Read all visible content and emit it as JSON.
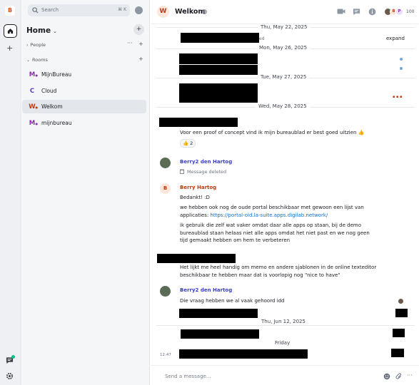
{
  "rail": {
    "logo_letter": "B",
    "accent": "#e0500f"
  },
  "sidebar": {
    "search": {
      "placeholder": "Search",
      "shortcut": "⌘ K"
    },
    "title": "Home",
    "sections": [
      {
        "label": "People"
      },
      {
        "label": "Rooms"
      }
    ],
    "rooms": [
      {
        "letter": "M",
        "name": "MijnBureau",
        "color": "#8a2ab0",
        "active": false
      },
      {
        "letter": "C",
        "name": "Cloud",
        "color": "#5b3cc4",
        "active": false
      },
      {
        "letter": "W",
        "name": "Welkom",
        "color": "#c0390c",
        "active": true
      },
      {
        "letter": "M",
        "name": "mijnbureau",
        "color": "#8a2ab0",
        "active": false
      }
    ]
  },
  "header": {
    "room_letter": "W",
    "room_name": "Welkom",
    "member_count": "100",
    "icons": [
      "video-icon",
      "threads-icon",
      "info-icon"
    ]
  },
  "timeline": {
    "dates": [
      "Thu, May 22, 2025",
      "Mon, May 26, 2025",
      "Tue, May 27, 2025",
      "Wed, May 28, 2025",
      "Thu, Jun 12, 2025",
      "Friday"
    ],
    "expand_label": "expand",
    "messages": {
      "proof": "Voor een proof of concept vind ik mijn bureaublad er best goed uitzien 👍",
      "reaction": "👍 2",
      "sender1": "Berry2 den Hartog",
      "deleted": "Message deleted",
      "sender2": "Berry Hartog",
      "sender2_initial": "B",
      "bedankt": "Bedankt! :D",
      "portal_prefix": "we hebben ook nog de oude portal beschikbaar met gewoon een lijst van applicaties: ",
      "portal_link": "https://portal-old.la-suite.apps.digilab.network/",
      "demo": "ik gebruik die zelf wat vaker omdat daar alle apps op staan, bij de demo bureaublad staan helaas niet alle apps omdat het niet past en we nog geen tijd gemaakt hebben om hem te verbeteren",
      "memo": "Het lijkt me heel handig om memo en andere sjablonen in de online texteditor beschikbaar te hebben maar dat is voorlopig nog \"nice to have\"",
      "sender3": "Berry2 den Hartog",
      "vraag": "Die vraag hebben we al vaak gehoord idd",
      "time": "12:47"
    }
  },
  "composer": {
    "placeholder": "Send a message..."
  }
}
